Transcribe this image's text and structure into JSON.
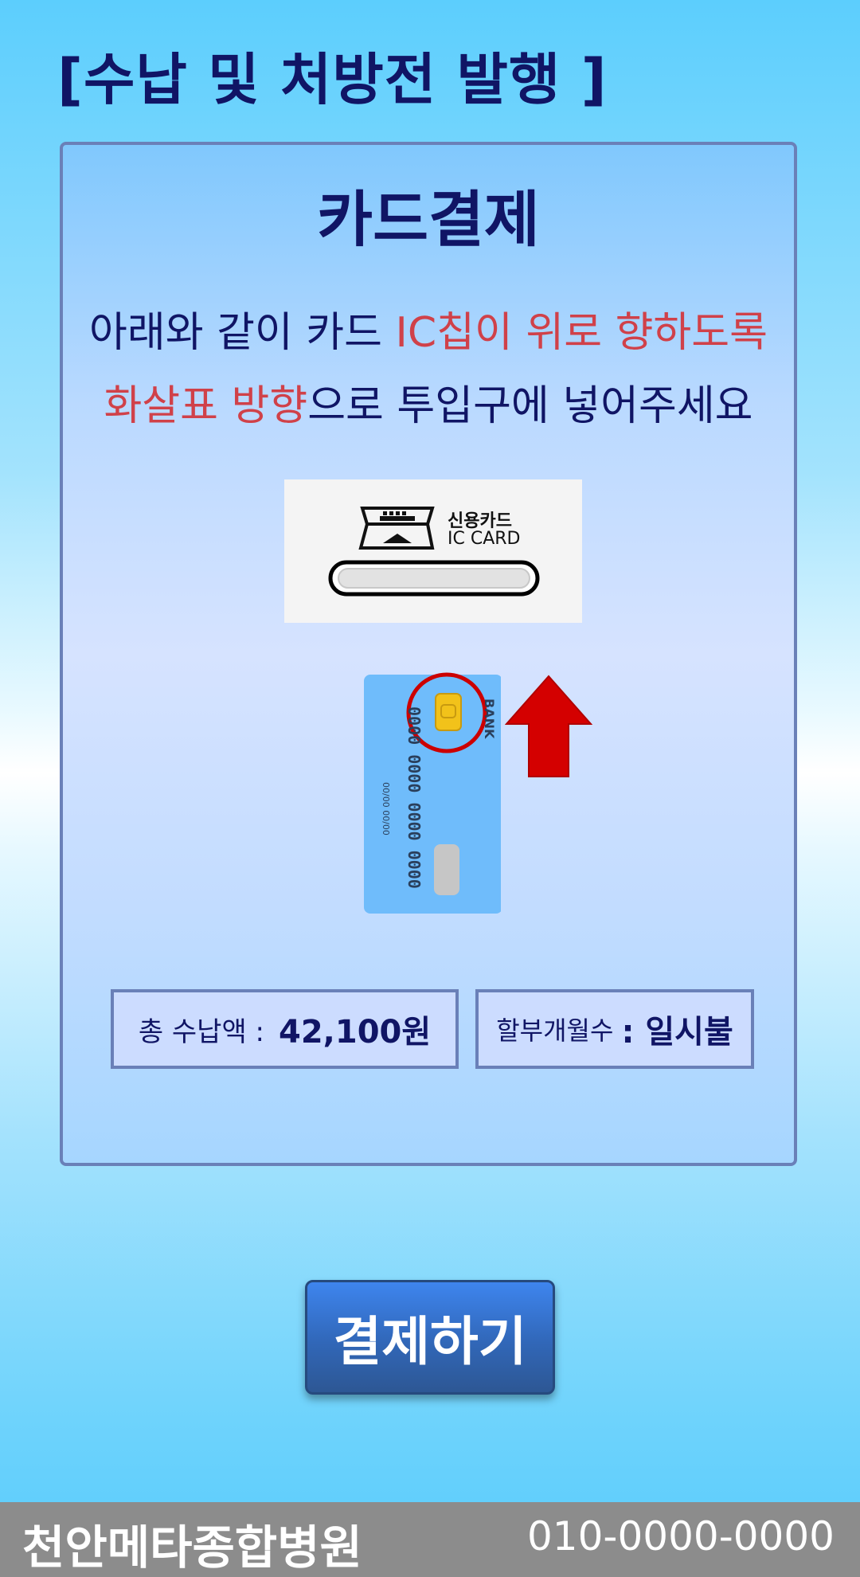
{
  "page": {
    "title": "[수납 및 처방전 발행 ]"
  },
  "panel": {
    "title": "카드결제",
    "instruction_line1": {
      "normal": "아래와 같이 카드 ",
      "highlight": "IC칩이 위로 향하도록"
    },
    "instruction_line2": {
      "highlight": "화살표 방향",
      "normal": "으로 투입구에 넣어주세요"
    },
    "reader": {
      "label_ko": "신용카드",
      "label_en": "IC CARD"
    },
    "card": {
      "number": "0000 0000 0000 0000",
      "expiry": "00/00  00/00",
      "bank": "BANK"
    },
    "total": {
      "label": "총 수납액 :",
      "value": "42,100원"
    },
    "installment": {
      "label": "할부개월수",
      "value": ": 일시불"
    }
  },
  "actions": {
    "pay_label": "결제하기"
  },
  "footer": {
    "hospital_name": "천안메타종합병원",
    "phone": "010-0000-0000"
  },
  "colors": {
    "accent_text": "#101565",
    "highlight_text": "#d04149",
    "button": "#3167b8",
    "footer": "#8c8c8c",
    "arrow": "#d40000"
  },
  "icons": [
    "card-reader-icon",
    "credit-card-icon",
    "ic-chip-icon",
    "up-arrow-icon"
  ]
}
